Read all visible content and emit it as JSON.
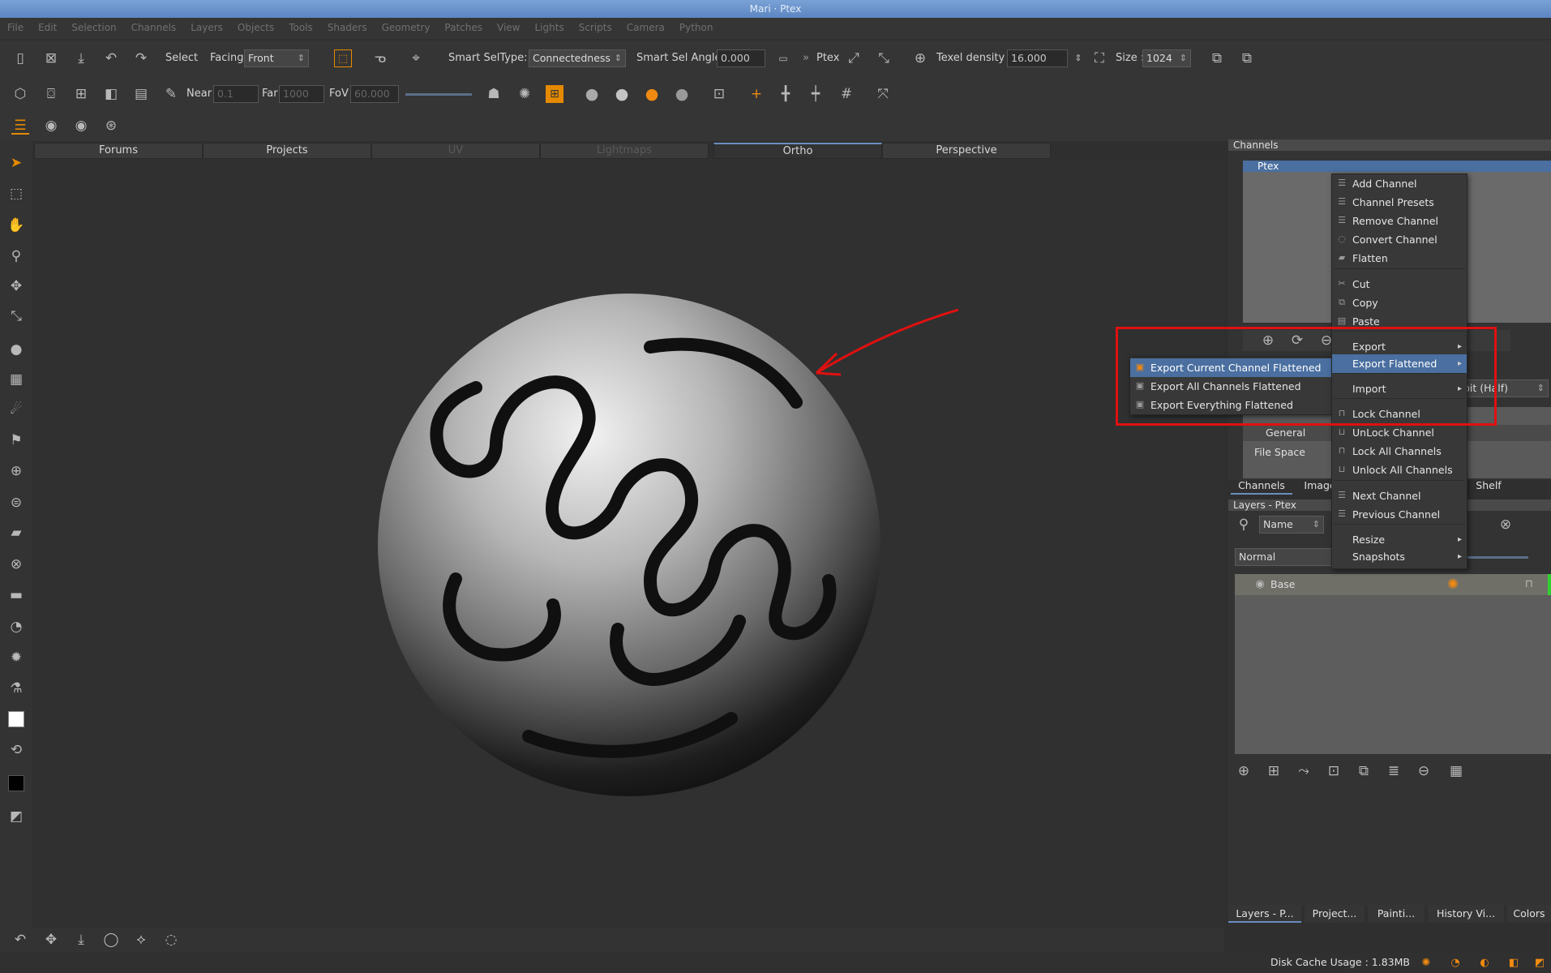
{
  "window": {
    "title": "Mari · Ptex"
  },
  "menubar": {
    "items": [
      "File",
      "Edit",
      "Selection",
      "Channels",
      "Layers",
      "Objects",
      "Tools",
      "Shaders",
      "Geometry",
      "Patches",
      "View",
      "Lights",
      "Scripts",
      "Camera",
      "Python"
    ]
  },
  "toolbar1": {
    "select_label": "Select",
    "facing_label": "Facing",
    "facing_value": "Front",
    "smart_sel_type_label": "Smart SelType:",
    "smart_sel_type_value": "Connectedness",
    "smart_sel_angle_label": "Smart Sel Angle",
    "smart_sel_angle_value": "0.000",
    "ptex_label": "Ptex",
    "texel_density_label": "Texel density :",
    "texel_density_value": "16.000",
    "size_label": "Size :",
    "size_value": "1024"
  },
  "toolbar2": {
    "near_label": "Near",
    "near_value": "0.1",
    "far_label": "Far",
    "far_value": "1000",
    "fov_label": "FoV",
    "fov_value": "60.000"
  },
  "view_tabs": [
    "Forums",
    "Projects",
    "UV",
    "Lightmaps",
    "Ortho",
    "Perspective"
  ],
  "active_view_tab": "Ortho",
  "channels_panel": {
    "title": "Channels",
    "channel_name": "Ptex",
    "general_label": "General",
    "file_space_label": "File Space",
    "depth_value": "bit (Half)"
  },
  "channel_menu": {
    "items": [
      {
        "label": "Add Channel",
        "icon": "add-channel-icon"
      },
      {
        "label": "Channel Presets",
        "icon": "presets-icon"
      },
      {
        "label": "Remove Channel",
        "icon": "remove-channel-icon"
      },
      {
        "label": "Convert Channel",
        "icon": "convert-icon"
      },
      {
        "label": "Flatten",
        "icon": "flatten-icon"
      },
      {
        "label": "Cut",
        "icon": "scissors-icon"
      },
      {
        "label": "Copy",
        "icon": "copy-icon"
      },
      {
        "label": "Paste",
        "icon": "paste-icon"
      },
      {
        "label": "Export",
        "icon": "",
        "submenu": true
      },
      {
        "label": "Export Flattened",
        "icon": "",
        "submenu": true
      },
      {
        "label": "Import",
        "icon": "",
        "submenu": true
      },
      {
        "label": "Lock Channel",
        "icon": "lock-icon"
      },
      {
        "label": "UnLock Channel",
        "icon": "unlock-icon"
      },
      {
        "label": "Lock All Channels",
        "icon": "lock-icon"
      },
      {
        "label": "Unlock All Channels",
        "icon": "unlock-icon"
      },
      {
        "label": "Next Channel",
        "icon": "next-icon"
      },
      {
        "label": "Previous Channel",
        "icon": "previous-icon"
      },
      {
        "label": "Resize",
        "icon": "",
        "submenu": true
      },
      {
        "label": "Snapshots",
        "icon": "",
        "submenu": true
      }
    ],
    "highlighted": "Export Flattened"
  },
  "export_flattened_submenu": {
    "items": [
      "Export Current Channel Flattened",
      "Export All Channels Flattened",
      "Export Everything Flattened"
    ],
    "highlighted": "Export Current Channel Flattened"
  },
  "middle_tabs": [
    "Channels",
    "Image",
    "Shelf"
  ],
  "layers_panel": {
    "title": "Layers - Ptex",
    "search_mode": "Name",
    "blend_mode": "Normal",
    "layer_name": "Base"
  },
  "bottom_tabs": [
    "Layers - P...",
    "Project...",
    "Painti...",
    "History Vi...",
    "Colors"
  ],
  "status": {
    "disk_cache": "Disk Cache Usage : 1.83MB"
  },
  "colors": {
    "accent": "#4a6fa0",
    "highlight_box": "#e01010",
    "arrow": "#e01010",
    "orange_icon": "#f08a10"
  }
}
